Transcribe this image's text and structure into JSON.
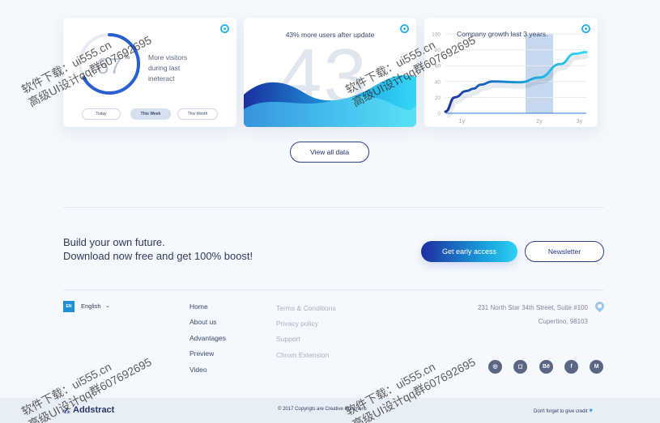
{
  "cards": {
    "visitors": {
      "percent_value": 67,
      "percent_symbol": "%",
      "text": "More visitors during last ineteract",
      "periods": [
        "Today",
        "This Week",
        "This Month"
      ],
      "active_period": "This Week"
    },
    "users": {
      "title": "43% more users after update",
      "big_number": "43"
    },
    "growth": {
      "title": "Company growth last 3 years."
    }
  },
  "chart_data": {
    "type": "line",
    "title": "Company growth last 3 years.",
    "x_tick_labels": [
      "1y",
      "2y",
      "3y"
    ],
    "y_tick_labels": [
      "0",
      "20",
      "40",
      "60",
      "80",
      "100"
    ],
    "ylim": [
      0,
      100
    ],
    "highlighted_category": "2y",
    "series": [
      {
        "x": [
          0.0,
          0.2,
          0.45,
          0.6,
          0.75,
          1.0,
          1.6,
          2.0,
          2.45,
          2.75,
          3.0
        ],
        "values": [
          2,
          20,
          28,
          31,
          36,
          40,
          39,
          45,
          62,
          75,
          77
        ]
      }
    ]
  },
  "view_all_label": "View all data",
  "cta": {
    "line1": "Build your own future.",
    "line2": "Download now free and get 100% boost!",
    "primary_button": "Get early access",
    "secondary_button": "Newsletter"
  },
  "footer": {
    "language_flag": "EN",
    "language": "English",
    "nav_links": [
      "Home",
      "About us",
      "Advantages",
      "Preview",
      "Video"
    ],
    "legal_links": [
      "Terms & Conditions",
      "Privacy policy",
      "Support",
      "Chrom Extension"
    ],
    "address_line1": "231 North Star  34th Street, Suite #100",
    "address_line2": "Cupertino, 98103",
    "socials": [
      "dribbble-icon",
      "instagram-icon",
      "behance-icon",
      "facebook-icon",
      "medium-icon"
    ],
    "social_glyphs": [
      "◎",
      "◻",
      "Bē",
      "f",
      "M"
    ],
    "brand": "Addstract",
    "copyright": "© 2017  Copyrigts are Creative Commons",
    "credit": "Don't forget to give credit",
    "heart": "♥"
  },
  "watermark": {
    "line1": "软件下载：ui555.cn",
    "line2": "高级UI设计qq群607692695"
  },
  "colors": {
    "accent": "#1aa6e0",
    "primary_dark": "#1d2ea0",
    "text": "#3b4a6b"
  }
}
